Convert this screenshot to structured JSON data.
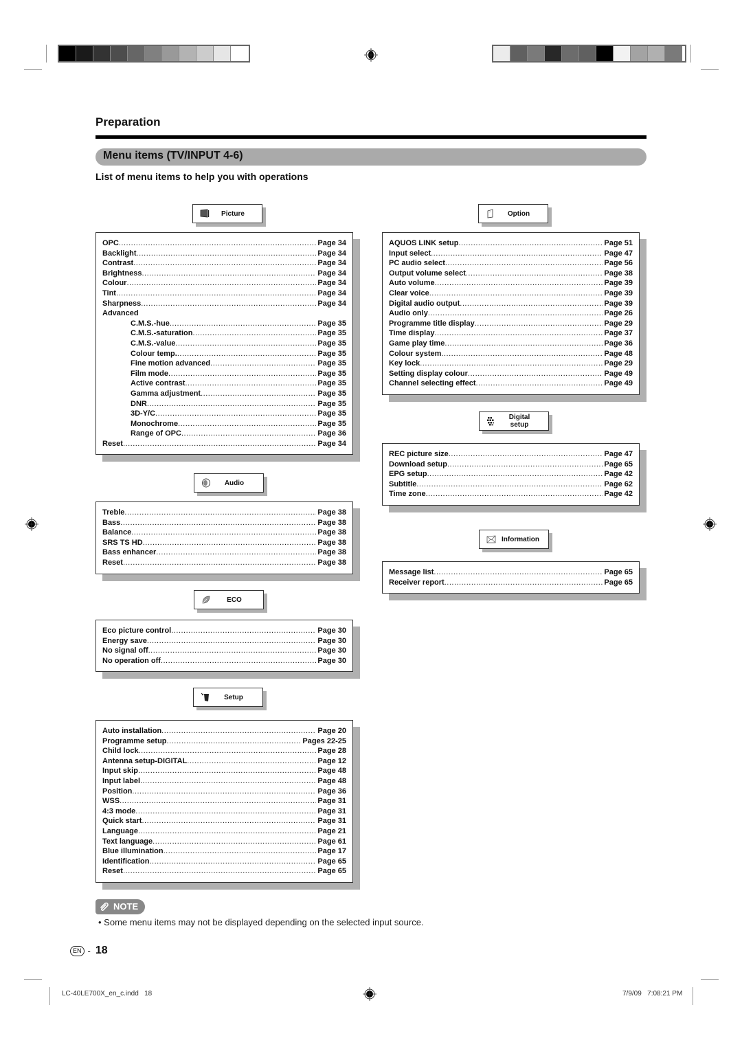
{
  "header": {
    "section": "Preparation",
    "title": "Menu items (TV/INPUT 4-6)",
    "subtitle": "List of menu items to help you with operations"
  },
  "color_bars": {
    "left": [
      "#000000",
      "#1a1a1a",
      "#333333",
      "#4d4d4d",
      "#666666",
      "#808080",
      "#999999",
      "#b3b3b3",
      "#cccccc",
      "#e6e6e6",
      "#ffffff"
    ],
    "right": [
      "#ececec",
      "#606060",
      "#7a7a7a",
      "#282828",
      "#6c6c6c",
      "#606060",
      "#000000",
      "#f2f2f2",
      "#a3a3a3",
      "#b0b0b0",
      "#7a7a7a"
    ]
  },
  "sections": {
    "picture": {
      "label": "Picture",
      "icon": "picture-icon",
      "items": [
        {
          "label": "OPC",
          "page": "Page 34"
        },
        {
          "label": "Backlight",
          "page": "Page 34"
        },
        {
          "label": "Contrast",
          "page": "Page 34"
        },
        {
          "label": "Brightness",
          "page": "Page 34"
        },
        {
          "label": "Colour",
          "page": "Page 34"
        },
        {
          "label": "Tint",
          "page": "Page 34"
        },
        {
          "label": "Sharpness",
          "page": "Page 34"
        },
        {
          "label": "Advanced",
          "page": ""
        },
        {
          "label": "C.M.S.-hue",
          "page": "Page 35",
          "indent": true
        },
        {
          "label": "C.M.S.-saturation",
          "page": "Page 35",
          "indent": true
        },
        {
          "label": "C.M.S.-value",
          "page": "Page 35",
          "indent": true
        },
        {
          "label": "Colour temp.",
          "page": "Page 35",
          "indent": true
        },
        {
          "label": "Fine motion advanced",
          "page": "Page 35",
          "indent": true
        },
        {
          "label": "Film mode",
          "page": "Page 35",
          "indent": true
        },
        {
          "label": "Active contrast",
          "page": "Page 35",
          "indent": true
        },
        {
          "label": "Gamma adjustment",
          "page": "Page 35",
          "indent": true
        },
        {
          "label": "DNR",
          "page": "Page 35",
          "indent": true
        },
        {
          "label": "3D-Y/C",
          "page": "Page 35",
          "indent": true
        },
        {
          "label": "Monochrome",
          "page": "Page 35",
          "indent": true
        },
        {
          "label": "Range of OPC",
          "page": "Page 36",
          "indent": true
        },
        {
          "label": "Reset",
          "page": "Page 34"
        }
      ]
    },
    "audio": {
      "label": "Audio",
      "icon": "speaker-icon",
      "items": [
        {
          "label": "Treble",
          "page": "Page 38"
        },
        {
          "label": "Bass",
          "page": "Page 38"
        },
        {
          "label": "Balance",
          "page": "Page 38"
        },
        {
          "label": "SRS TS HD",
          "page": "Page 38"
        },
        {
          "label": "Bass enhancer",
          "page": "Page 38"
        },
        {
          "label": "Reset",
          "page": "Page 38"
        }
      ]
    },
    "eco": {
      "label": "ECO",
      "icon": "leaf-icon",
      "items": [
        {
          "label": "Eco picture control",
          "page": "Page 30"
        },
        {
          "label": "Energy save",
          "page": "Page 30"
        },
        {
          "label": "No signal off",
          "page": "Page 30"
        },
        {
          "label": "No operation off",
          "page": "Page 30"
        }
      ]
    },
    "setup": {
      "label": "Setup",
      "icon": "wrench-icon",
      "items": [
        {
          "label": "Auto installation",
          "page": "Page 20"
        },
        {
          "label": "Programme setup",
          "page": "Pages 22-25"
        },
        {
          "label": "Child lock",
          "page": "Page 28"
        },
        {
          "label": "Antenna setup-DIGITAL",
          "page": "Page 12"
        },
        {
          "label": "Input skip",
          "page": "Page 48"
        },
        {
          "label": "Input label",
          "page": "Page 48"
        },
        {
          "label": "Position",
          "page": "Page 36"
        },
        {
          "label": "WSS",
          "page": "Page 31"
        },
        {
          "label": "4:3 mode",
          "page": "Page 31"
        },
        {
          "label": "Quick start",
          "page": "Page 31"
        },
        {
          "label": "Language",
          "page": "Page 21"
        },
        {
          "label": "Text language",
          "page": "Page 61"
        },
        {
          "label": "Blue illumination",
          "page": "Page 17"
        },
        {
          "label": "Identification",
          "page": "Page 65"
        },
        {
          "label": "Reset",
          "page": "Page 65"
        }
      ]
    },
    "option": {
      "label": "Option",
      "icon": "option-icon",
      "items": [
        {
          "label": "AQUOS LINK setup",
          "page": "Page 51"
        },
        {
          "label": "Input select",
          "page": "Page 47"
        },
        {
          "label": "PC audio select",
          "page": "Page 56"
        },
        {
          "label": "Output volume select",
          "page": "Page 38"
        },
        {
          "label": "Auto volume",
          "page": "Page 39"
        },
        {
          "label": "Clear voice",
          "page": "Page 39"
        },
        {
          "label": "Digital audio output",
          "page": "Page 39"
        },
        {
          "label": "Audio only",
          "page": "Page 26"
        },
        {
          "label": "Programme title display",
          "page": "Page 29"
        },
        {
          "label": "Time display",
          "page": "Page 37"
        },
        {
          "label": "Game play time",
          "page": "Page 36"
        },
        {
          "label": "Colour system",
          "page": "Page 48"
        },
        {
          "label": "Key lock",
          "page": "Page 29"
        },
        {
          "label": "Setting display colour",
          "page": "Page 49"
        },
        {
          "label": "Channel selecting effect",
          "page": "Page 49"
        }
      ]
    },
    "digital": {
      "label": "Digital setup",
      "icon": "digital-grid-icon",
      "items": [
        {
          "label": "REC picture size",
          "page": "Page 47"
        },
        {
          "label": "Download setup",
          "page": "Page 65"
        },
        {
          "label": "EPG setup",
          "page": "Page 42"
        },
        {
          "label": "Subtitle",
          "page": "Page 62"
        },
        {
          "label": "Time zone",
          "page": "Page 42"
        }
      ]
    },
    "information": {
      "label": "Information",
      "icon": "envelope-icon",
      "items": [
        {
          "label": "Message list",
          "page": "Page 65"
        },
        {
          "label": "Receiver report",
          "page": "Page 65"
        }
      ]
    }
  },
  "note": {
    "badge": "NOTE",
    "text": "• Some menu items may not be displayed depending on the selected input source."
  },
  "page": {
    "lang": "EN",
    "number": "18",
    "separator": "-"
  },
  "footer": {
    "file": "LC-40LE700X_en_c.indd   18",
    "datetime": "7/9/09   7:08:21 PM"
  }
}
